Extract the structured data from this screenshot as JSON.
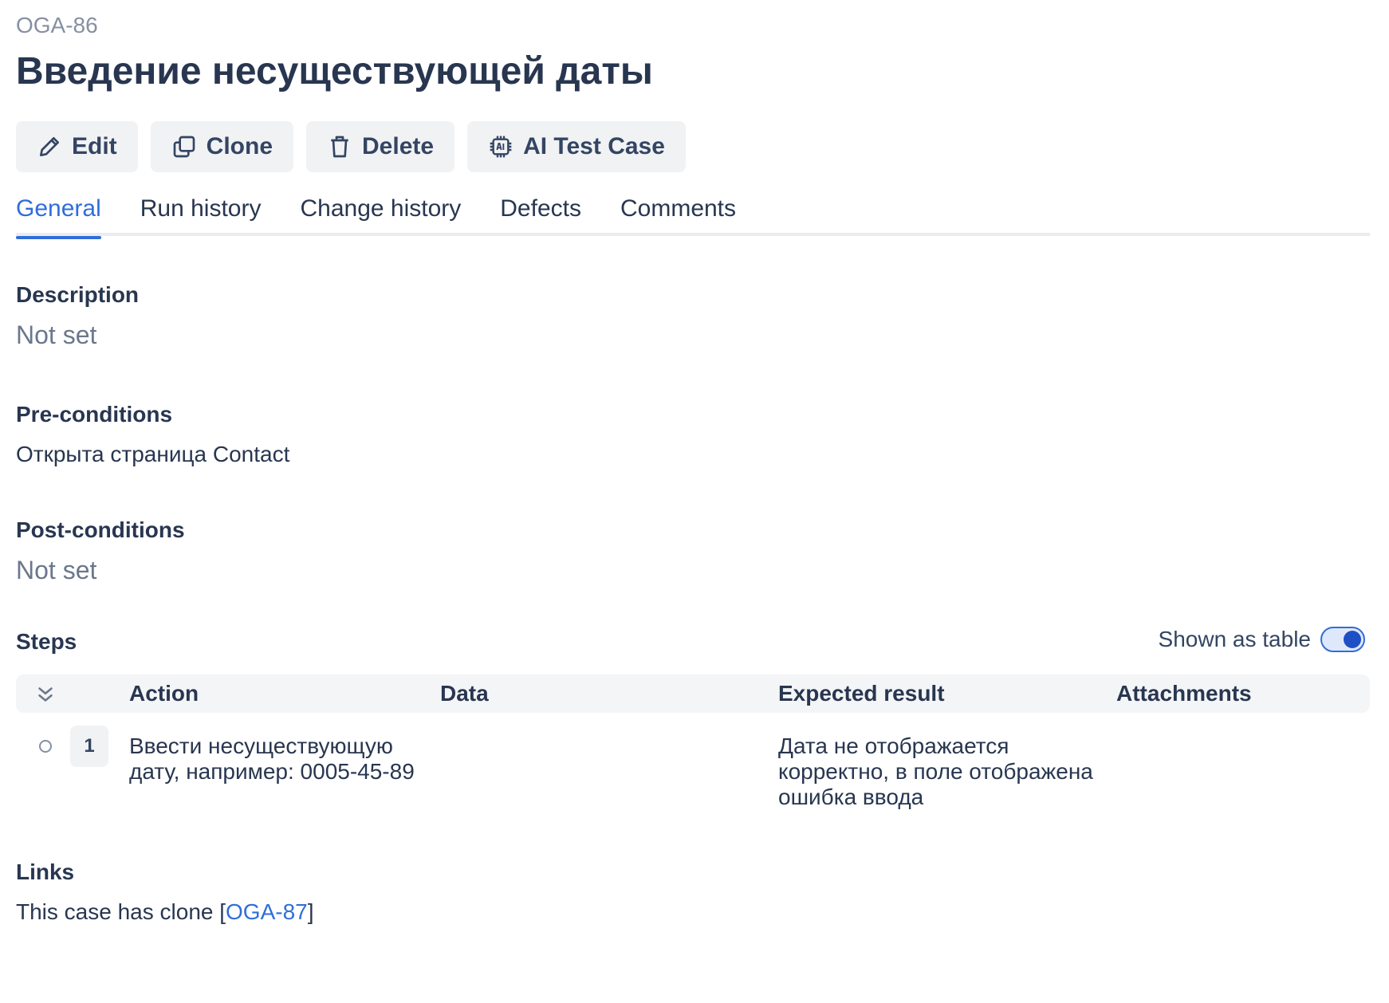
{
  "case": {
    "key": "OGA-86",
    "title": "Введение несуществующей даты"
  },
  "toolbar": {
    "edit_label": "Edit",
    "clone_label": "Clone",
    "delete_label": "Delete",
    "ai_label": "AI Test Case"
  },
  "tabs": [
    {
      "label": "General",
      "active": true
    },
    {
      "label": "Run history",
      "active": false
    },
    {
      "label": "Change history",
      "active": false
    },
    {
      "label": "Defects",
      "active": false
    },
    {
      "label": "Comments",
      "active": false
    }
  ],
  "description": {
    "label": "Description",
    "value": "Not set"
  },
  "preconditions": {
    "label": "Pre-conditions",
    "value": "Открыта страница Contact"
  },
  "postconditions": {
    "label": "Post-conditions",
    "value": "Not set"
  },
  "steps": {
    "label": "Steps",
    "toggle_label": "Shown as table",
    "toggle_on": true,
    "columns": {
      "action": "Action",
      "data": "Data",
      "expected": "Expected result",
      "attachments": "Attachments"
    },
    "rows": [
      {
        "number": "1",
        "action": "Ввести несуществующую дату, например: 0005-45-89",
        "data": "",
        "expected": "Дата не отображается корректно, в поле отображена ошибка ввода",
        "attachments": ""
      }
    ]
  },
  "links": {
    "label": "Links",
    "prefix": "This case has clone [",
    "link_text": "OGA-87",
    "suffix": "]"
  },
  "colors": {
    "accent": "#2f6ed8",
    "muted": "#6b778c",
    "text": "#283650"
  }
}
